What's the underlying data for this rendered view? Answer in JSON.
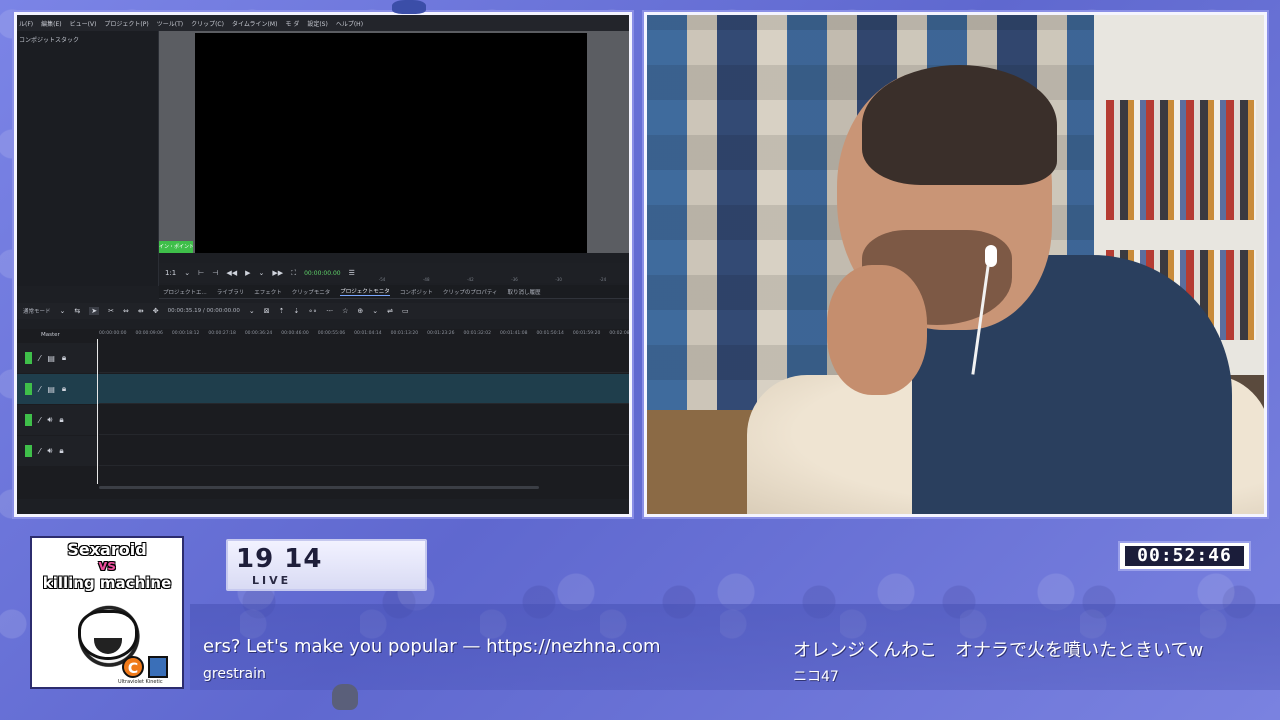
{
  "editor": {
    "menu": [
      "ル(F)",
      "編集(E)",
      "ビュー(V)",
      "プロジェクト(P)",
      "ツール(T)",
      "クリップ(C)",
      "タイムライン(M)",
      "モ ダ",
      "設定(S)",
      "ヘルプ(H)"
    ],
    "composition_panel_title": "コンポジットスタック",
    "inpoint_label": "イン・ポイント",
    "transport_zoom": "1:1",
    "transport_timecode": "00:00:00.00",
    "meter_ticks": [
      "-54",
      "-48",
      "-42",
      "-36",
      "-30",
      "-24"
    ],
    "tabs": [
      "プロジェクトエ...",
      "ライブラリ",
      "エフェクト",
      "クリップモニタ",
      "プロジェクトモニタ",
      "コンポジット",
      "クリップのプロパティ",
      "取り消し履歴"
    ],
    "active_tab_index": 4,
    "toolbar_mode": "通常モード",
    "toolbar_timecode": "00:00:35.19 / 00:00:00.00",
    "timeline_master_label": "Master",
    "ruler_ticks": [
      "00:00:00:00",
      "00:00:09:06",
      "00:00:18:12",
      "00:00:27:18",
      "00:00:36:24",
      "00:00:46:00",
      "00:00:55:06",
      "00:01:04:14",
      "00:01:13:20",
      "00:01:23:26",
      "00:01:32:02",
      "00:01:41:08",
      "00:01:50:14",
      "00:01:59:20",
      "00:02:08:26"
    ],
    "track_icons": [
      "film-icon",
      "film-icon",
      "speaker-icon",
      "speaker-icon"
    ],
    "selected_track_index": 1
  },
  "overlay": {
    "artwork": {
      "line1": "Sexaroid",
      "line2": "vs",
      "line3": "killing machine",
      "badge_c": "C",
      "credit": "Ultraviolet Kinetic"
    },
    "viewers": {
      "count": "19 14",
      "status": "LIVE"
    },
    "clock": "00:52:46",
    "ticker": [
      {
        "message": "ers? Let's make you popular — https://nezhna.com",
        "user": "grestrain"
      },
      {
        "message": "オレンジくんわこ　オナラで火を噴いたときいてw",
        "user": "ニコ47"
      }
    ]
  },
  "colors": {
    "background": "#6f78d9",
    "frame_border": "#f4f4ff",
    "editor_bg": "#1d1f24",
    "timecode_green": "#5fd36a",
    "selected_track": "#1f3e4c"
  }
}
